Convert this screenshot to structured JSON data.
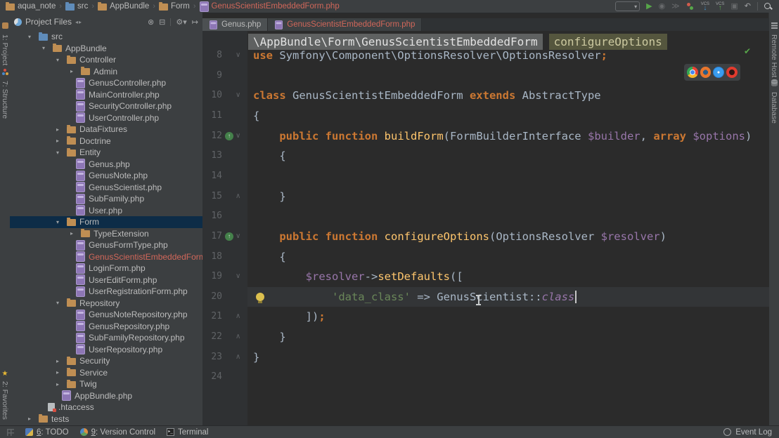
{
  "colors": {
    "accent_red_file": "#d1675a",
    "selection": "#0d2c47",
    "keyword": "#cc7832",
    "method": "#ffc66d",
    "variable": "#9876aa",
    "string": "#6a8759",
    "plain_code": "#a9b7c6",
    "editor_bg": "#2b2b2b",
    "panel_bg": "#3c3f41"
  },
  "breadcrumb_bar": {
    "items": [
      {
        "label": "aqua_note",
        "icon": "folder"
      },
      {
        "label": "src",
        "icon": "folder-src"
      },
      {
        "label": "AppBundle",
        "icon": "folder"
      },
      {
        "label": "Form",
        "icon": "folder"
      },
      {
        "label": "GenusScientistEmbeddedForm.php",
        "icon": "php",
        "red": true
      }
    ],
    "separator": "›"
  },
  "main_toolbar": {
    "run_config_chevron": "▾",
    "icons": [
      {
        "name": "run-icon",
        "glyph": "▶",
        "cls": "green"
      },
      {
        "name": "debug-icon",
        "glyph": "◉",
        "cls": "grayed"
      },
      {
        "name": "coverage-icon",
        "glyph": "≫",
        "cls": "grayed"
      },
      {
        "name": "profiler-icon",
        "glyph": "",
        "cls": "profiler"
      },
      {
        "name": "vcs-update-icon",
        "glyph": "↓",
        "cls": "blue",
        "cap": "VCS"
      },
      {
        "name": "vcs-push-icon",
        "glyph": "↑",
        "cls": "green",
        "cap": "VCS"
      },
      {
        "name": "vcs-dialog-icon",
        "glyph": "▣",
        "cls": "grayed"
      },
      {
        "name": "undo-icon",
        "glyph": "↶",
        "cls": ""
      }
    ]
  },
  "left_stripe": {
    "items": [
      {
        "label": "1: Project",
        "icon": "project-icon"
      },
      {
        "label": "7: Structure",
        "icon": "structure-icon"
      },
      {
        "label": "2: Favorites",
        "icon": "favorites-star-icon",
        "bottom": true
      }
    ]
  },
  "right_stripe": {
    "items": [
      {
        "label": "Remote Host",
        "icon": "remote-host-icon"
      },
      {
        "label": "Database",
        "icon": "database-icon"
      }
    ]
  },
  "project_panel": {
    "title": "Project Files",
    "header_icons": [
      {
        "name": "scroll-from-source-icon",
        "glyph": "⊗"
      },
      {
        "name": "collapse-all-icon",
        "glyph": "⊟"
      },
      {
        "name": "separator",
        "glyph": ""
      },
      {
        "name": "gear-icon",
        "glyph": "⚙▾"
      },
      {
        "name": "hide-panel-icon",
        "glyph": "↦"
      }
    ],
    "tree": [
      {
        "label": "src",
        "level": 1,
        "icon": "folder-src",
        "arrow": "open"
      },
      {
        "label": "AppBundle",
        "level": 2,
        "icon": "folder",
        "arrow": "open"
      },
      {
        "label": "Controller",
        "level": 3,
        "icon": "folder",
        "arrow": "open"
      },
      {
        "label": "Admin",
        "level": 4,
        "icon": "folder",
        "arrow": "closed"
      },
      {
        "label": "GenusController.php",
        "level": 4,
        "icon": "php",
        "arrow": "none"
      },
      {
        "label": "MainController.php",
        "level": 4,
        "icon": "php",
        "arrow": "none"
      },
      {
        "label": "SecurityController.php",
        "level": 4,
        "icon": "php",
        "arrow": "none"
      },
      {
        "label": "UserController.php",
        "level": 4,
        "icon": "php",
        "arrow": "none"
      },
      {
        "label": "DataFixtures",
        "level": 3,
        "icon": "folder",
        "arrow": "closed"
      },
      {
        "label": "Doctrine",
        "level": 3,
        "icon": "folder",
        "arrow": "closed"
      },
      {
        "label": "Entity",
        "level": 3,
        "icon": "folder",
        "arrow": "open"
      },
      {
        "label": "Genus.php",
        "level": 4,
        "icon": "php",
        "arrow": "none"
      },
      {
        "label": "GenusNote.php",
        "level": 4,
        "icon": "php",
        "arrow": "none"
      },
      {
        "label": "GenusScientist.php",
        "level": 4,
        "icon": "php",
        "arrow": "none"
      },
      {
        "label": "SubFamily.php",
        "level": 4,
        "icon": "php",
        "arrow": "none"
      },
      {
        "label": "User.php",
        "level": 4,
        "icon": "php",
        "arrow": "none"
      },
      {
        "label": "Form",
        "level": 3,
        "icon": "folder",
        "arrow": "open",
        "selected": true
      },
      {
        "label": "TypeExtension",
        "level": 4,
        "icon": "folder",
        "arrow": "closed"
      },
      {
        "label": "GenusFormType.php",
        "level": 4,
        "icon": "php",
        "arrow": "none"
      },
      {
        "label": "GenusScientistEmbeddedForm.php",
        "level": 4,
        "icon": "php",
        "arrow": "none",
        "red": true
      },
      {
        "label": "LoginForm.php",
        "level": 4,
        "icon": "php",
        "arrow": "none"
      },
      {
        "label": "UserEditForm.php",
        "level": 4,
        "icon": "php",
        "arrow": "none"
      },
      {
        "label": "UserRegistrationForm.php",
        "level": 4,
        "icon": "php",
        "arrow": "none"
      },
      {
        "label": "Repository",
        "level": 3,
        "icon": "folder",
        "arrow": "open"
      },
      {
        "label": "GenusNoteRepository.php",
        "level": 4,
        "icon": "php",
        "arrow": "none"
      },
      {
        "label": "GenusRepository.php",
        "level": 4,
        "icon": "php",
        "arrow": "none"
      },
      {
        "label": "SubFamilyRepository.php",
        "level": 4,
        "icon": "php",
        "arrow": "none"
      },
      {
        "label": "UserRepository.php",
        "level": 4,
        "icon": "php",
        "arrow": "none"
      },
      {
        "label": "Security",
        "level": 3,
        "icon": "folder",
        "arrow": "closed"
      },
      {
        "label": "Service",
        "level": 3,
        "icon": "folder",
        "arrow": "closed"
      },
      {
        "label": "Twig",
        "level": 3,
        "icon": "folder",
        "arrow": "closed"
      },
      {
        "label": "AppBundle.php",
        "level": 3,
        "icon": "php",
        "arrow": "none"
      },
      {
        "label": ".htaccess",
        "level": 2,
        "icon": "htaccess",
        "arrow": "none"
      },
      {
        "label": "tests",
        "level": 1,
        "icon": "folder",
        "arrow": "closed"
      }
    ]
  },
  "editor": {
    "tabs": [
      {
        "label": "Genus.php",
        "active": false
      },
      {
        "label": "GenusScientistEmbeddedForm.php",
        "active": true
      }
    ],
    "header": {
      "namespace": "\\AppBundle\\Form\\GenusScientistEmbeddedForm",
      "method": "configureOptions"
    },
    "inspection_status": "✔",
    "browser_icons": [
      "chrome-icon",
      "firefox-icon",
      "safari-icon",
      "opera-icon"
    ],
    "lines": [
      {
        "n": 8,
        "fold": "open",
        "tk": [
          [
            "k",
            "use"
          ],
          [
            "t",
            " Symfony\\Component\\OptionsResolver\\OptionsResolver"
          ],
          [
            "k",
            ";"
          ]
        ]
      },
      {
        "n": 9,
        "tk": []
      },
      {
        "n": 10,
        "fold": "open",
        "tk": [
          [
            "k",
            "class"
          ],
          [
            "t",
            " GenusScientistEmbeddedForm "
          ],
          [
            "k",
            "extends"
          ],
          [
            "t",
            " AbstractType"
          ]
        ]
      },
      {
        "n": 11,
        "tk": [
          [
            "t",
            "{"
          ]
        ]
      },
      {
        "n": 12,
        "fold": "open",
        "override": true,
        "tk": [
          [
            "t",
            "    "
          ],
          [
            "k",
            "public"
          ],
          [
            "t",
            " "
          ],
          [
            "k",
            "function"
          ],
          [
            "t",
            " "
          ],
          [
            "m",
            "buildForm"
          ],
          [
            "t",
            "(FormBuilderInterface "
          ],
          [
            "v",
            "$builder"
          ],
          [
            "t",
            ", "
          ],
          [
            "k",
            "array"
          ],
          [
            "t",
            " "
          ],
          [
            "v",
            "$options"
          ],
          [
            "t",
            ")"
          ]
        ]
      },
      {
        "n": 13,
        "tk": [
          [
            "t",
            "    {"
          ]
        ]
      },
      {
        "n": 14,
        "tk": []
      },
      {
        "n": 15,
        "fold": "close",
        "tk": [
          [
            "t",
            "    }"
          ]
        ]
      },
      {
        "n": 16,
        "tk": []
      },
      {
        "n": 17,
        "fold": "open",
        "override": true,
        "tk": [
          [
            "t",
            "    "
          ],
          [
            "k",
            "public"
          ],
          [
            "t",
            " "
          ],
          [
            "k",
            "function"
          ],
          [
            "t",
            " "
          ],
          [
            "m",
            "configureOptions"
          ],
          [
            "t",
            "(OptionsResolver "
          ],
          [
            "v",
            "$resolver"
          ],
          [
            "t",
            ")"
          ]
        ]
      },
      {
        "n": 18,
        "tk": [
          [
            "t",
            "    {"
          ]
        ]
      },
      {
        "n": 19,
        "fold": "open",
        "tk": [
          [
            "t",
            "        "
          ],
          [
            "v",
            "$resolver"
          ],
          [
            "t",
            "->"
          ],
          [
            "m",
            "setDefaults"
          ],
          [
            "t",
            "(["
          ]
        ]
      },
      {
        "n": 20,
        "current": true,
        "bulb": true,
        "caret": true,
        "tk": [
          [
            "t",
            "            "
          ],
          [
            "s",
            "'data_class'"
          ],
          [
            "t",
            " => GenusScientist::"
          ],
          [
            "c",
            "class"
          ]
        ]
      },
      {
        "n": 21,
        "fold": "close",
        "tk": [
          [
            "t",
            "        ])"
          ],
          [
            "k",
            ";"
          ]
        ]
      },
      {
        "n": 22,
        "fold": "close",
        "tk": [
          [
            "t",
            "    }"
          ]
        ]
      },
      {
        "n": 23,
        "fold": "close",
        "tk": [
          [
            "t",
            "}"
          ]
        ]
      },
      {
        "n": 24,
        "tk": []
      }
    ]
  },
  "status_bar": {
    "left_items": [
      {
        "mnemonic": "6",
        "rest": ": TODO",
        "icon": "todo-icon"
      },
      {
        "mnemonic": "9",
        "rest": ": Version Control",
        "icon": "version-control-icon"
      },
      {
        "mnemonic": "",
        "rest": "Terminal",
        "icon": "terminal-icon"
      }
    ],
    "right_label": "Event Log"
  }
}
